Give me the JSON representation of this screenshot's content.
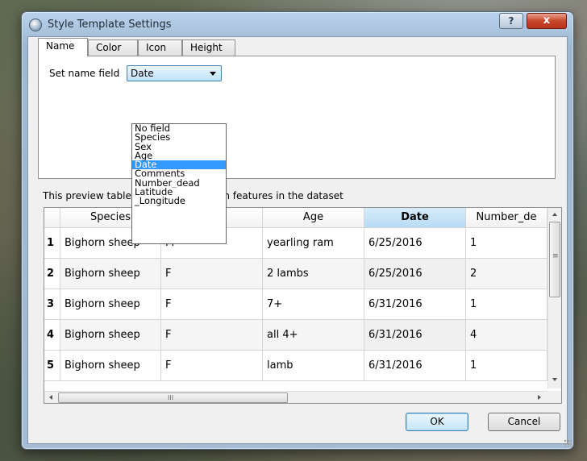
{
  "window": {
    "title": "Style Template Settings",
    "help_label": "?",
    "close_label": "x"
  },
  "tabs": [
    {
      "label": "Name",
      "active": true
    },
    {
      "label": "Color",
      "active": false
    },
    {
      "label": "Icon",
      "active": false
    },
    {
      "label": "Height",
      "active": false
    }
  ],
  "name_field": {
    "label": "Set name field",
    "selected": "Date",
    "options": [
      "No field",
      "Species",
      "Sex",
      "Age",
      "Date",
      "Comments",
      "Number_dead",
      "Latitude",
      "_Longitude"
    ],
    "selected_index": 4
  },
  "preview": {
    "caption_start": "This preview table",
    "caption_end": "en features in the dataset"
  },
  "table": {
    "columns": [
      "",
      "Species",
      "",
      "Age",
      "Date",
      "Number_de"
    ],
    "sorted_column": "Date",
    "rows": [
      [
        "1",
        "Bighorn sheep",
        "M",
        "yearling ram",
        "6/25/2016",
        "1"
      ],
      [
        "2",
        "Bighorn sheep",
        "F",
        "2 lambs",
        "6/25/2016",
        "2"
      ],
      [
        "3",
        "Bighorn sheep",
        "F",
        "7+",
        "6/31/2016",
        "1"
      ],
      [
        "4",
        "Bighorn sheep",
        "F",
        "all 4+",
        "6/31/2016",
        "4"
      ],
      [
        "5",
        "Bighorn sheep",
        "F",
        "lamb",
        "6/31/2016",
        "1"
      ]
    ],
    "hscroll_glyph": "III",
    "vscroll_glyph": "≡"
  },
  "buttons": {
    "ok": "OK",
    "cancel": "Cancel"
  },
  "colors": {
    "selection": "#3399ff",
    "sorted_header": "#b6dbf5",
    "close_button": "#c9462c"
  }
}
